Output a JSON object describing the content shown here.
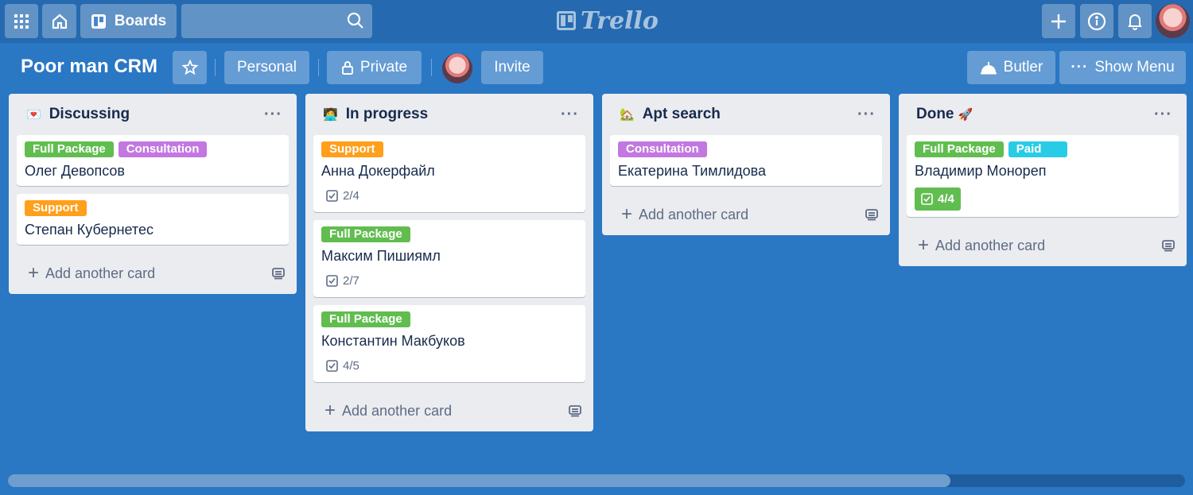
{
  "colors": {
    "board_bg": "#2a77c4",
    "label_green": "#61bd4f",
    "label_purple": "#c377e0",
    "label_orange": "#ff9f1a",
    "label_sky": "#29cce5"
  },
  "topbar": {
    "apps_icon": "grid-icon",
    "home_icon": "home-icon",
    "boards_label": "Boards",
    "search_value": "",
    "logo_text": "Trello",
    "create_icon": "plus-icon",
    "info_icon": "info-icon",
    "notifications_icon": "bell-icon"
  },
  "board": {
    "title": "Poor man CRM",
    "personal_label": "Personal",
    "private_label": "Private",
    "invite_label": "Invite",
    "butler_label": "Butler",
    "show_menu_label": "Show Menu"
  },
  "lists": [
    {
      "title": "Discussing",
      "emoji": "💌",
      "add_card": "Add another card",
      "cards": [
        {
          "labels": [
            {
              "text": "Full Package",
              "color": "green"
            },
            {
              "text": "Consultation",
              "color": "purple"
            }
          ],
          "title": "Олег Девопсов"
        },
        {
          "labels": [
            {
              "text": "Support",
              "color": "orange"
            }
          ],
          "title": "Степан Кубернетес"
        }
      ]
    },
    {
      "title": "In progress",
      "emoji": "🧑‍💻",
      "add_card": "Add another card",
      "cards": [
        {
          "labels": [
            {
              "text": "Support",
              "color": "orange"
            }
          ],
          "title": "Анна Докерфайл",
          "checklist": "2/4"
        },
        {
          "labels": [
            {
              "text": "Full Package",
              "color": "green"
            }
          ],
          "title": "Максим Пишиямл",
          "checklist": "2/7"
        },
        {
          "labels": [
            {
              "text": "Full Package",
              "color": "green"
            }
          ],
          "title": "Константин Макбуков",
          "checklist": "4/5"
        }
      ]
    },
    {
      "title": "Apt search",
      "emoji": "🏡",
      "add_card": "Add another card",
      "cards": [
        {
          "labels": [
            {
              "text": "Consultation",
              "color": "purple"
            }
          ],
          "title": "Екатерина Тимлидова"
        }
      ]
    },
    {
      "title": "Done",
      "emoji": "🚀",
      "add_card": "Add another card",
      "cards": [
        {
          "labels": [
            {
              "text": "Full Package",
              "color": "green"
            },
            {
              "text": "Paid",
              "color": "sky"
            }
          ],
          "title": "Владимир Монореп",
          "checklist": "4/4"
        }
      ]
    }
  ]
}
